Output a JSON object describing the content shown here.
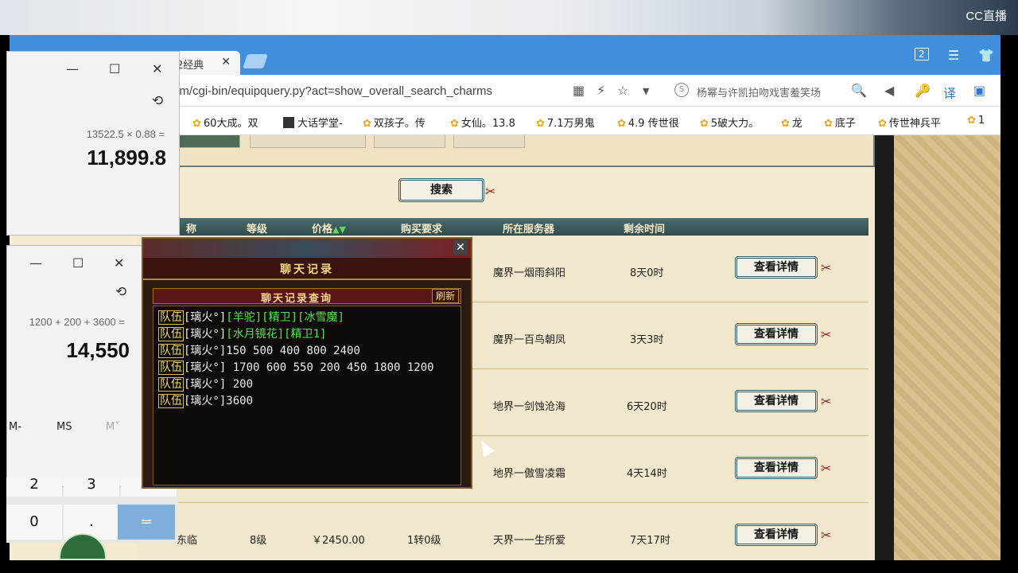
{
  "stream": {
    "logo": "CC直播"
  },
  "browser": {
    "tab_label": "2经典",
    "tab_close": "✕",
    "url": "om/cgi-bin/equipquery.py?act=show_overall_search_charms",
    "search_text": "杨幂与许凯拍吻戏害羞笑场",
    "tabbar_icons": [
      "tab-count-icon",
      "menu-icon",
      "skin-icon"
    ],
    "tab_count": "2",
    "bookmarks": [
      "60大成。双",
      "大话学堂-",
      "双孩子。传",
      "女仙。13.8",
      "7.1万男鬼",
      "4.9 传世很",
      "5破大力。",
      "龙",
      "底子",
      "传世神兵平",
      "1"
    ]
  },
  "game": {
    "search_button": "搜索",
    "headers": [
      "称",
      "等级",
      "价格",
      "购买要求",
      "所在服务器",
      "剩余时间"
    ],
    "rows": [
      {
        "server": "魔界一烟雨斜阳",
        "time": "8天0时",
        "button": "查看详情"
      },
      {
        "server": "魔界一百鸟朝凤",
        "time": "3天3时",
        "button": "查看详情"
      },
      {
        "server": "地界一剑蚀沧海",
        "time": "6天20时",
        "button": "查看详情"
      },
      {
        "server": "地界一傲雪凌霜",
        "time": "4天14时",
        "button": "查看详情"
      },
      {
        "name": "东临",
        "level": "8级",
        "price": "￥2450.00",
        "req": "1转0级",
        "server": "天界一一生所爱",
        "time": "7天17时",
        "button": "查看详情"
      }
    ]
  },
  "calc1": {
    "expression": "13522.5 × 0.88 =",
    "result": "11,899.8",
    "min": "—",
    "max": "☐",
    "close": "✕",
    "mem_partial": [
      "M-",
      "MS",
      "M˅"
    ]
  },
  "calc2": {
    "expression": "1200 + 200 + 3600 =",
    "result": "14,550",
    "min": "—",
    "max": "☐",
    "close": "✕",
    "mem": [
      "M-",
      "MS",
      "M˅"
    ],
    "keys": [
      "2",
      "3",
      "+",
      "0",
      ".",
      "="
    ]
  },
  "chat": {
    "title": "聊天记录",
    "subtitle": "聊天记录查询",
    "refresh": "刷新",
    "close": "✕",
    "tag": "队伍",
    "lines": [
      {
        "user": "[璃火°]",
        "green": "[羊驼][精卫][冰雪魔]",
        "text": ""
      },
      {
        "user": "[璃火°]",
        "green": "[水月镜花][精卫1]",
        "text": ""
      },
      {
        "user": "[璃火°]",
        "green": "",
        "text": "150 500 400 800 2400"
      },
      {
        "user": "[璃火°]",
        "green": "",
        "text": " 1700 600 550 200 450 1800 1200"
      },
      {
        "user": "[璃火°]",
        "green": "",
        "text": " 200"
      },
      {
        "user": "[璃火°]",
        "green": "",
        "text": "3600"
      }
    ]
  }
}
